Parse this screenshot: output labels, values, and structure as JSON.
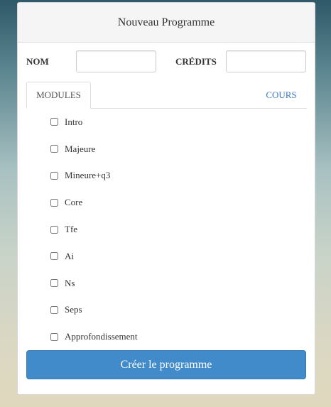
{
  "header": {
    "title": "Nouveau Programme"
  },
  "form": {
    "nom_label": "NOM",
    "nom_value": "",
    "credits_label": "CRÉDITS",
    "credits_value": ""
  },
  "tabs": [
    {
      "label": "MODULES",
      "active": true
    },
    {
      "label": "COURS",
      "active": false
    }
  ],
  "modules": [
    {
      "label": "Intro",
      "checked": false
    },
    {
      "label": "Majeure",
      "checked": false
    },
    {
      "label": "Mineure+q3",
      "checked": false
    },
    {
      "label": "Core",
      "checked": false
    },
    {
      "label": "Tfe",
      "checked": false
    },
    {
      "label": "Ai",
      "checked": false
    },
    {
      "label": "Ns",
      "checked": false
    },
    {
      "label": "Seps",
      "checked": false
    },
    {
      "label": "Approfondissement",
      "checked": false
    }
  ],
  "submit_label": "Créer le programme",
  "colors": {
    "primary": "#428bca",
    "link": "#3a7bbf"
  }
}
